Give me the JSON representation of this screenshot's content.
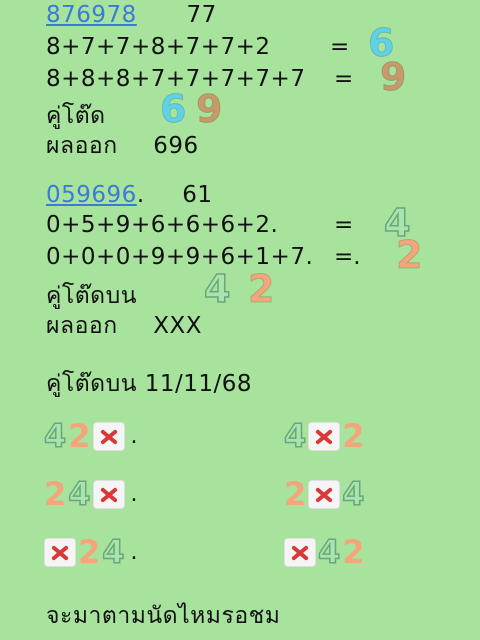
{
  "block1": {
    "code": "876978",
    "num": "77",
    "sum1": "8+7+7+8+7+7+2",
    "eq1": "=",
    "res1": "6",
    "sum2": "8+8+8+7+7+7+7+7",
    "eq2": "=",
    "res2": "9",
    "pair_label": "คู่โต๊ด",
    "pair_a": "6",
    "pair_b": "9",
    "result_label": "ผลออก",
    "result_value": "696"
  },
  "block2": {
    "code": "059696",
    "code_dot": ".",
    "num": "61",
    "sum1": "0+5+9+6+6+6+2.",
    "eq1": "=",
    "res1": "4",
    "sum2": "0+0+0+9+9+6+1+7.",
    "eq2": "=.",
    "res2": "2",
    "pair_label": "คู่โต๊ดบน",
    "pair_a": "4",
    "pair_b": "2",
    "result_label": "ผลออก",
    "result_value": "XXX"
  },
  "date_line": "คู่โต๊ดบน 11/11/68",
  "combos": [
    {
      "a": "4",
      "b": "2",
      "dot": "."
    },
    {
      "a": "4",
      "b": "2"
    },
    {
      "a": "2",
      "b": "4",
      "dot": "."
    },
    {
      "a": "2",
      "b": "4"
    },
    {
      "a": "2",
      "b": "4",
      "dot": "."
    },
    {
      "a": "4",
      "b": "2"
    }
  ],
  "footer": "จะมาตามนัดไหมรอชม",
  "colors": {
    "background": "#a8e39d",
    "link": "#3a7bd5",
    "cross": "#d93838"
  }
}
